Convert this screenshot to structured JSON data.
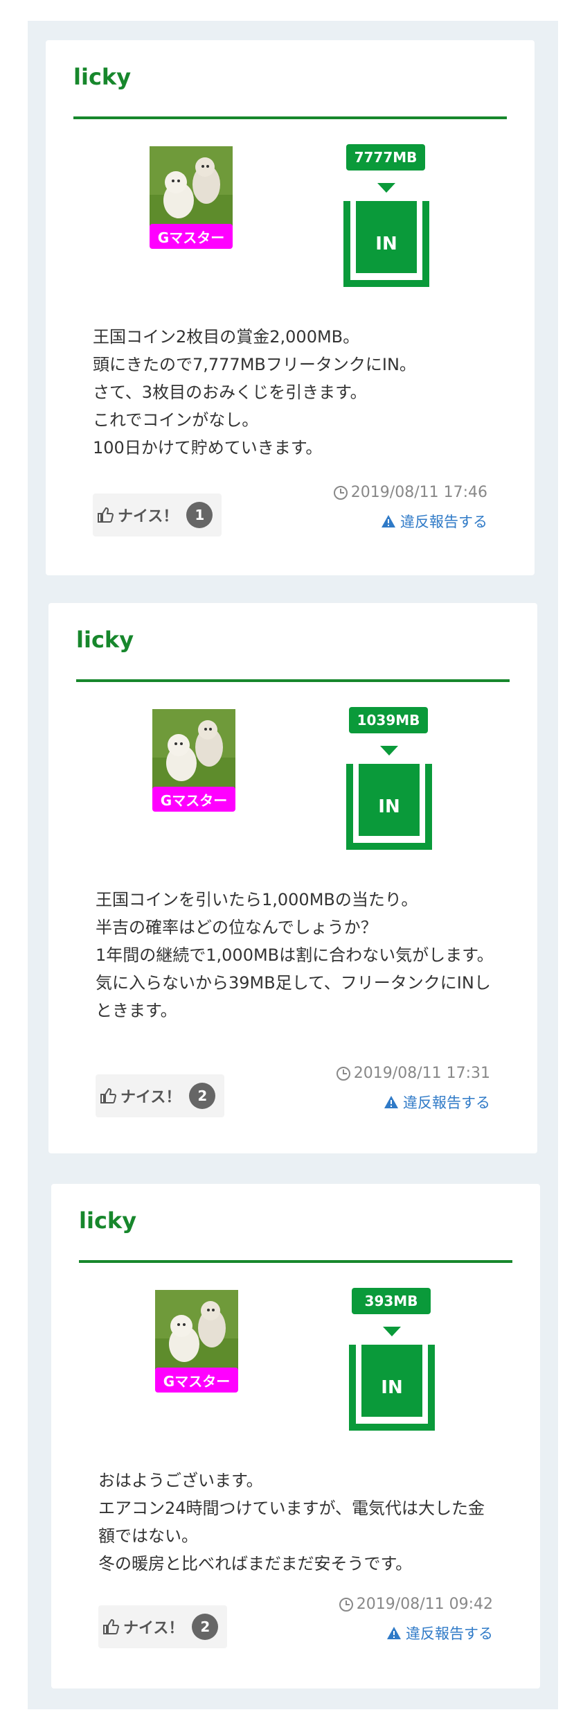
{
  "posts": [
    {
      "user": "licky",
      "badge": "Gマスター",
      "mb": "7777MB",
      "tank": "IN",
      "message": "王国コイン2枚目の賞金2,000MB。\n頭にきたので7,777MBフリータンクにIN。\nさて、3枚目のおみくじを引きます。\nこれでコインがなし。\n100日かけて貯めていきます。",
      "nice_label": "ナイス！",
      "nice_count": "1",
      "timestamp": "2019/08/11 17:46",
      "report": "違反報告する"
    },
    {
      "user": "licky",
      "badge": "Gマスター",
      "mb": "1039MB",
      "tank": "IN",
      "message": "王国コインを引いたら1,000MBの当たり。\n半吉の確率はどの位なんでしょうか？\n1年間の継続で1,000MBは割に合わない気がします。\n気に入らないから39MB足して、フリータンクにINしときます。",
      "nice_label": "ナイス！",
      "nice_count": "2",
      "timestamp": "2019/08/11 17:31",
      "report": "違反報告する"
    },
    {
      "user": "licky",
      "badge": "Gマスター",
      "mb": "393MB",
      "tank": "IN",
      "message": "おはようございます。\nエアコン24時間つけていますが、電気代は大した金額ではない。\n冬の暖房と比べればまだまだ安そうです。",
      "nice_label": "ナイス！",
      "nice_count": "2",
      "timestamp": "2019/08/11 09:42",
      "report": "違反報告する"
    }
  ],
  "colors": {
    "accent_green": "#17872c",
    "tank_green": "#0a9a3a",
    "badge_magenta": "#ff00ff",
    "link_blue": "#2f7ac7",
    "page_bg": "#eaf0f4"
  },
  "icons": {
    "thumb": "thumbs-up-icon",
    "clock": "clock-icon",
    "warning": "warning-icon"
  }
}
